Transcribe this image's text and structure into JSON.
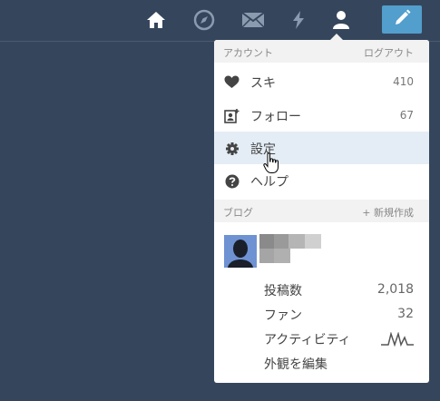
{
  "topbar": {
    "icons": [
      "home-icon",
      "compass-icon",
      "mail-icon",
      "lightning-icon",
      "account-icon",
      "pencil-icon"
    ]
  },
  "account": {
    "header": "アカウント",
    "logout": "ログアウト",
    "items": [
      {
        "label": "スキ",
        "count": "410",
        "icon": "heart-icon"
      },
      {
        "label": "フォロー",
        "count": "67",
        "icon": "follow-icon"
      },
      {
        "label": "設定",
        "icon": "gear-icon"
      },
      {
        "label": "ヘルプ",
        "icon": "help-icon"
      }
    ]
  },
  "blog": {
    "header": "ブログ",
    "new_blog": "+ 新規作成",
    "stats": [
      {
        "label": "投稿数",
        "value": "2,018"
      },
      {
        "label": "ファン",
        "value": "32"
      },
      {
        "label": "アクティビティ"
      }
    ],
    "edit_appearance": "外観を編集"
  },
  "colors": {
    "background": "#35465c",
    "accent": "#529ecc",
    "menu_active": "#e4edf5"
  }
}
